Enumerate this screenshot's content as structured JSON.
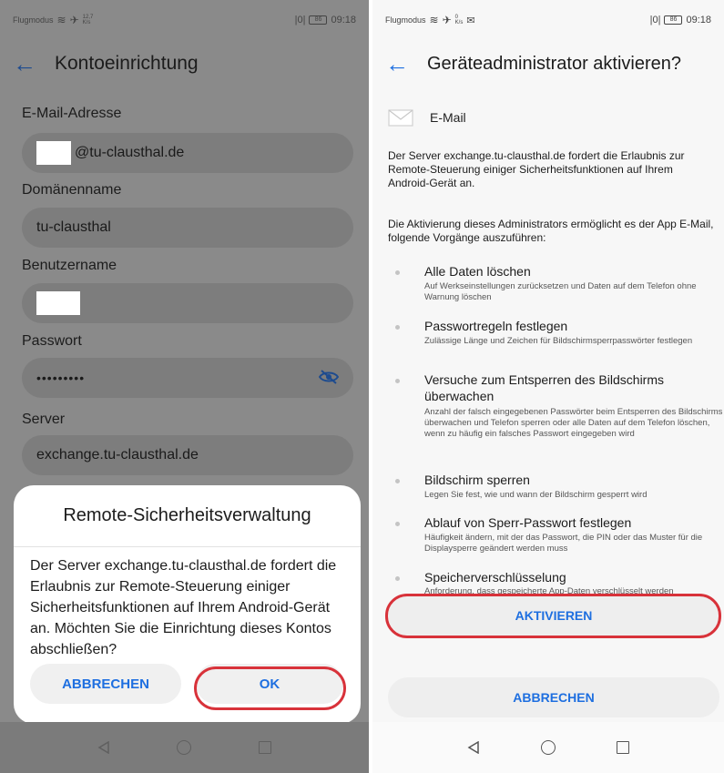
{
  "left": {
    "status": {
      "mode": "Flugmodus",
      "speed": "12,7",
      "speed_unit": "K/s",
      "battery": "86",
      "time": "09:18"
    },
    "title": "Kontoeinrichtung",
    "fields": {
      "email_label": "E-Mail-Adresse",
      "email_value": "@tu-clausthal.de",
      "domain_label": "Domänenname",
      "domain_value": "tu-clausthal",
      "user_label": "Benutzername",
      "user_value": "",
      "password_label": "Passwort",
      "password_value": "•••••••••",
      "server_label": "Server",
      "server_value": "exchange.tu-clausthal.de"
    },
    "dialog": {
      "title": "Remote-Sicherheitsverwaltung",
      "body": "Der Server exchange.tu-clausthal.de fordert die Erlaubnis zur Remote-Steuerung einiger Sicherheitsfunktionen auf Ihrem Android-Gerät an. Möchten Sie die Einrichtung dieses Kontos abschließen?",
      "cancel": "ABBRECHEN",
      "ok": "OK"
    }
  },
  "right": {
    "status": {
      "mode": "Flugmodus",
      "speed": "0",
      "speed_unit": "K/s",
      "battery": "86",
      "time": "09:18"
    },
    "title": "Geräteadministrator aktivieren?",
    "app_name": "E-Mail",
    "intro": "Der Server exchange.tu-clausthal.de fordert die Erlaubnis zur Remote-Steuerung einiger Sicherheitsfunktionen auf Ihrem Android-Gerät an.",
    "intro2": "Die Aktivierung dieses Administrators ermöglicht es der App E-Mail, folgende Vorgänge auszuführen:",
    "permissions": [
      {
        "title": "Alle Daten löschen",
        "desc": "Auf Werkseinstellungen zurücksetzen und Daten auf dem Telefon ohne Warnung löschen"
      },
      {
        "title": "Passwortregeln festlegen",
        "desc": "Zulässige Länge und Zeichen für Bildschirmsperrpasswörter festlegen"
      },
      {
        "title": "Versuche zum Entsperren des Bildschirms überwachen",
        "desc": "Anzahl der falsch eingegebenen Passwörter beim Entsperren des Bildschirms überwachen und Telefon sperren oder alle Daten auf dem Telefon löschen, wenn zu häufig ein falsches Passwort eingegeben wird"
      },
      {
        "title": "Bildschirm sperren",
        "desc": "Legen Sie fest, wie und wann der Bildschirm gesperrt wird"
      },
      {
        "title": "Ablauf von Sperr-Passwort festlegen",
        "desc": "Häufigkeit ändern, mit der das Passwort, die PIN oder das Muster für die Displaysperre geändert werden muss"
      },
      {
        "title": "Speicherverschlüsselung",
        "desc": "Anforderung, dass gespeicherte App-Daten verschlüsselt werden"
      }
    ],
    "activate": "AKTIVIEREN",
    "cancel": "ABBRECHEN"
  },
  "colors": {
    "accent": "#1e6fe0",
    "highlight_ring": "#d8323a"
  }
}
